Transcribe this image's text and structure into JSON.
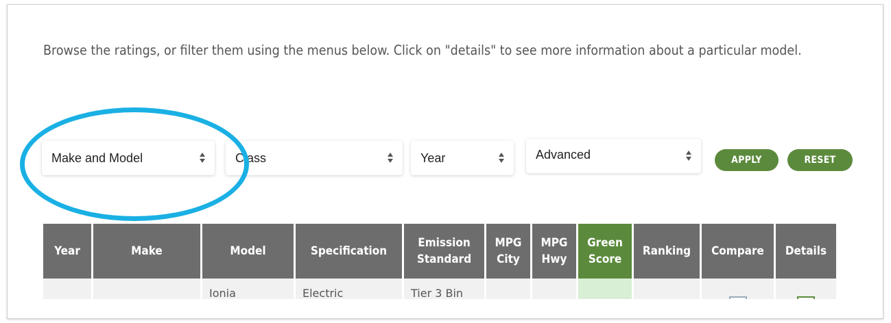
{
  "intro": "Browse the ratings, or filter them using the menus below. Click on \"details\" to see more information about a particular model.",
  "filters": {
    "make_model": "Make and Model",
    "class": "Class",
    "year": "Year",
    "advanced": "Advanced"
  },
  "buttons": {
    "apply": "APPLY",
    "reset": "RESET"
  },
  "table": {
    "headers": [
      "Year",
      "Make",
      "Model",
      "Specification",
      "Emission Standard",
      "MPG City",
      "MPG Hwy",
      "Green Score",
      "Ranking",
      "Compare",
      "Details"
    ],
    "row1": [
      "",
      "",
      "Ionia",
      "Electric",
      "Tier 3 Bin",
      "",
      "",
      "",
      "",
      "",
      ""
    ]
  },
  "colors": {
    "accent_green": "#5b8a3c",
    "highlight_circle": "#1ab0e4",
    "header_gray": "#6d6d6d"
  }
}
